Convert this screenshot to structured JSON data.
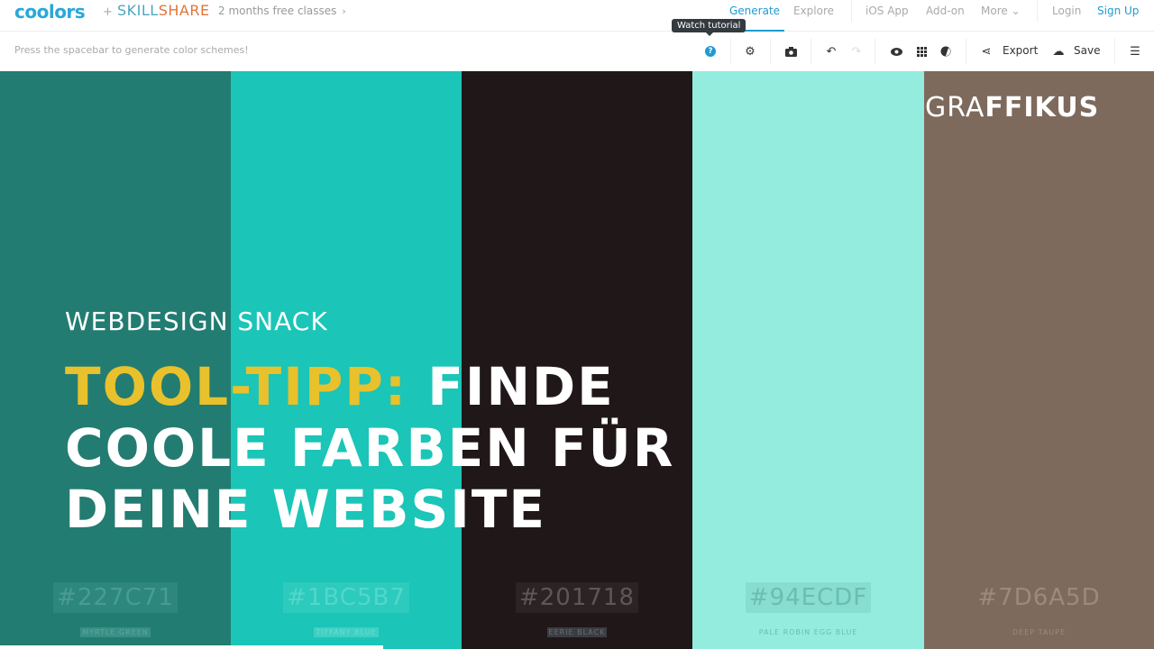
{
  "topbar": {
    "logo": "coolors",
    "plus": "+",
    "partner_part1": "SKILL",
    "partner_part2": "SHARE",
    "promo": "2 months free classes",
    "promo_chevron": "›",
    "nav": [
      {
        "label": "Generate",
        "active": true
      },
      {
        "label": "Explore",
        "active": false
      },
      {
        "label": "iOS App",
        "active": false
      },
      {
        "label": "Add-on",
        "active": false
      },
      {
        "label": "More",
        "active": false
      },
      {
        "label": "Login",
        "active": false
      },
      {
        "label": "Sign Up",
        "active": true
      }
    ],
    "more_chevron": "⌄"
  },
  "toolbar": {
    "hint": "Press the spacebar to generate color schemes!",
    "tooltip": "Watch tutorial",
    "help_glyph": "?",
    "export_label": "Export",
    "save_label": "Save"
  },
  "palette": [
    {
      "hex": "#227C71",
      "name": "MYRTLE GREEN",
      "color": "#227c71"
    },
    {
      "hex": "#1BC5B7",
      "name": "TIFFANY BLUE",
      "color": "#1bc5b7"
    },
    {
      "hex": "#201718",
      "name": "EERIE BLACK",
      "color": "#201718"
    },
    {
      "hex": "#94ECDF",
      "name": "PALE ROBIN EGG BLUE",
      "color": "#94ecdf"
    },
    {
      "hex": "#7D6A5D",
      "name": "DEEP TAUPE",
      "color": "#7d6a5d"
    }
  ],
  "overlay": {
    "brand_light": "GRA",
    "brand_bold": "FFIKUS",
    "subtitle": "WEBDESIGN SNACK",
    "headline_accent": "TOOL-TIPP:",
    "headline_line1_rest": " FINDE",
    "headline_line2": "COOLE FARBEN FÜR",
    "headline_line3": "DEINE WEBSITE",
    "accent_color": "#e8c12c"
  }
}
